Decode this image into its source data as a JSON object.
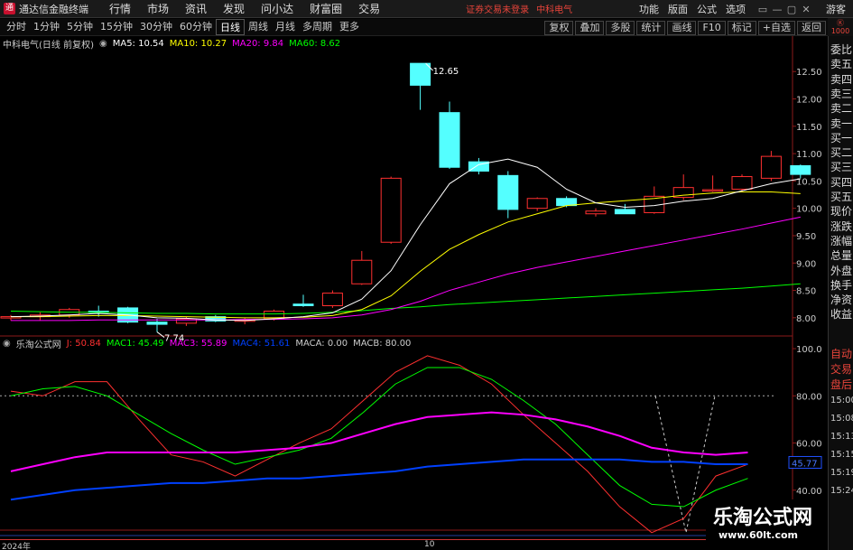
{
  "app": {
    "title": "通达信金融终端",
    "logo_glyph": "通"
  },
  "menu": [
    "行情",
    "市场",
    "资讯",
    "发现",
    "问小达",
    "财富圈",
    "交易"
  ],
  "status": {
    "text": "证券交易未登录",
    "stock": "中科电气"
  },
  "right_menu": [
    "功能",
    "版面",
    "公式",
    "选项"
  ],
  "window_buttons": [
    "▭",
    "—",
    "▢",
    "✕"
  ],
  "guest": "游客",
  "top_badge": [
    "Ⓚ",
    "1000"
  ],
  "periods": [
    {
      "label": "分时",
      "active": false
    },
    {
      "label": "1分钟",
      "active": false
    },
    {
      "label": "5分钟",
      "active": false
    },
    {
      "label": "15分钟",
      "active": false
    },
    {
      "label": "30分钟",
      "active": false
    },
    {
      "label": "60分钟",
      "active": false
    },
    {
      "label": "日线",
      "active": true
    },
    {
      "label": "周线",
      "active": false
    },
    {
      "label": "月线",
      "active": false
    },
    {
      "label": "多周期",
      "active": false
    },
    {
      "label": "更多",
      "active": false
    }
  ],
  "tools": [
    "复权",
    "叠加",
    "多股",
    "统计",
    "画线",
    "F10",
    "标记",
    "+自选",
    "返回"
  ],
  "main_legend": {
    "stock": "中科电气(日线 前复权)",
    "items": [
      {
        "label": "MA5: 10.54",
        "color": "#ffffff"
      },
      {
        "label": "MA10: 10.27",
        "color": "#ffff00"
      },
      {
        "label": "MA20: 9.84",
        "color": "#ff00ff"
      },
      {
        "label": "MA60: 8.62",
        "color": "#00ff00"
      }
    ]
  },
  "sub_legend": {
    "name": "乐淘公式网",
    "items": [
      {
        "label": "J: 50.84",
        "color": "#ff3030"
      },
      {
        "label": "MAC1: 45.49",
        "color": "#00ff00"
      },
      {
        "label": "MAC3: 55.89",
        "color": "#ff00ff"
      },
      {
        "label": "MAC4: 51.61",
        "color": "#0040ff"
      },
      {
        "label": "MACA: 0.00",
        "color": "#cccccc"
      },
      {
        "label": "MACB: 80.00",
        "color": "#cccccc"
      }
    ]
  },
  "side_panel": {
    "items": [
      "委比",
      "卖五",
      "卖四",
      "卖三",
      "卖二",
      "卖一",
      "买一",
      "买二",
      "买三",
      "买四",
      "买五",
      "现价",
      "涨跌",
      "涨幅",
      "总量",
      "外盘",
      "换手",
      "净资",
      "收益"
    ],
    "lower": [
      {
        "label": "自动",
        "red": true
      },
      {
        "label": "交易",
        "red": true
      },
      {
        "label": "盘后",
        "red": true
      }
    ],
    "times": [
      "15:00",
      "15:08",
      "15:13",
      "15:15",
      "15:19",
      "15:24"
    ]
  },
  "price_axis": [
    "12.50",
    "12.00",
    "11.50",
    "11.00",
    "10.50",
    "10.00",
    "9.50",
    "9.00",
    "8.50",
    "8.00"
  ],
  "sub_axis": [
    "100.0",
    "80.00",
    "60.00",
    "40.00"
  ],
  "sub_axis_marker": "45.77",
  "annotations": {
    "high": "12.65",
    "low": "7.74"
  },
  "date_labels": [
    "2024年",
    "10"
  ],
  "watermark": {
    "main": "乐淘公式网",
    "url": "www.60lt.com"
  },
  "colors": {
    "up": "#ff3030",
    "down": "#54ffff",
    "ma5": "#ffffff",
    "ma10": "#ffff00",
    "ma20": "#ff00ff",
    "ma60": "#00ff00"
  },
  "chart_data": {
    "type": "candlestick",
    "candles": [
      {
        "o": 8.0,
        "h": 8.05,
        "l": 7.95,
        "c": 8.02
      },
      {
        "o": 8.02,
        "h": 8.1,
        "l": 7.95,
        "c": 8.05
      },
      {
        "o": 8.05,
        "h": 8.18,
        "l": 8.0,
        "c": 8.15
      },
      {
        "o": 8.12,
        "h": 8.22,
        "l": 8.02,
        "c": 8.1
      },
      {
        "o": 8.18,
        "h": 8.2,
        "l": 7.9,
        "c": 7.92
      },
      {
        "o": 7.92,
        "h": 7.98,
        "l": 7.74,
        "c": 7.88
      },
      {
        "o": 7.9,
        "h": 8.02,
        "l": 7.85,
        "c": 7.98
      },
      {
        "o": 8.02,
        "h": 8.05,
        "l": 7.92,
        "c": 7.94
      },
      {
        "o": 7.95,
        "h": 8.0,
        "l": 7.88,
        "c": 7.96
      },
      {
        "o": 7.98,
        "h": 8.15,
        "l": 7.95,
        "c": 8.12
      },
      {
        "o": 8.25,
        "h": 8.42,
        "l": 8.2,
        "c": 8.22
      },
      {
        "o": 8.22,
        "h": 8.5,
        "l": 8.18,
        "c": 8.45
      },
      {
        "o": 8.62,
        "h": 9.22,
        "l": 8.6,
        "c": 9.05
      },
      {
        "o": 9.38,
        "h": 10.58,
        "l": 9.35,
        "c": 10.55
      },
      {
        "o": 12.65,
        "h": 12.65,
        "l": 11.8,
        "c": 12.25
      },
      {
        "o": 11.75,
        "h": 11.95,
        "l": 10.72,
        "c": 10.75
      },
      {
        "o": 10.85,
        "h": 10.92,
        "l": 10.62,
        "c": 10.68
      },
      {
        "o": 10.6,
        "h": 10.68,
        "l": 9.82,
        "c": 9.98
      },
      {
        "o": 10.0,
        "h": 10.2,
        "l": 9.95,
        "c": 10.18
      },
      {
        "o": 10.18,
        "h": 10.22,
        "l": 10.02,
        "c": 10.05
      },
      {
        "o": 9.9,
        "h": 10.0,
        "l": 9.85,
        "c": 9.95
      },
      {
        "o": 9.98,
        "h": 10.08,
        "l": 9.95,
        "c": 9.9
      },
      {
        "o": 9.92,
        "h": 10.4,
        "l": 9.9,
        "c": 10.22
      },
      {
        "o": 10.2,
        "h": 10.62,
        "l": 10.15,
        "c": 10.38
      },
      {
        "o": 10.32,
        "h": 10.6,
        "l": 10.3,
        "c": 10.34
      },
      {
        "o": 10.35,
        "h": 10.62,
        "l": 10.3,
        "c": 10.58
      },
      {
        "o": 10.55,
        "h": 11.05,
        "l": 10.5,
        "c": 10.95
      },
      {
        "o": 10.78,
        "h": 10.8,
        "l": 10.55,
        "c": 10.62
      }
    ],
    "ma5": [
      8.02,
      8.03,
      8.05,
      8.08,
      8.05,
      8.0,
      7.99,
      7.96,
      7.95,
      7.98,
      8.02,
      8.09,
      8.34,
      8.86,
      9.7,
      10.45,
      10.8,
      10.9,
      10.75,
      10.35,
      10.1,
      10.02,
      10.05,
      10.13,
      10.18,
      10.32,
      10.45,
      10.54
    ],
    "ma10": [
      8.02,
      8.02,
      8.03,
      8.04,
      8.04,
      8.03,
      8.02,
      8.01,
      8.0,
      8.0,
      8.01,
      8.04,
      8.15,
      8.4,
      8.85,
      9.25,
      9.52,
      9.75,
      9.9,
      10.05,
      10.1,
      10.14,
      10.18,
      10.24,
      10.28,
      10.3,
      10.3,
      10.27
    ],
    "ma20": [
      7.95,
      7.95,
      7.95,
      7.96,
      7.96,
      7.96,
      7.96,
      7.96,
      7.97,
      7.97,
      7.98,
      8.0,
      8.05,
      8.15,
      8.3,
      8.5,
      8.65,
      8.8,
      8.92,
      9.02,
      9.12,
      9.22,
      9.32,
      9.42,
      9.52,
      9.62,
      9.73,
      9.84
    ],
    "ma60": [
      8.12,
      8.11,
      8.1,
      8.1,
      8.09,
      8.08,
      8.08,
      8.07,
      8.07,
      8.07,
      8.08,
      8.1,
      8.13,
      8.17,
      8.2,
      8.24,
      8.27,
      8.3,
      8.33,
      8.36,
      8.39,
      8.42,
      8.45,
      8.48,
      8.51,
      8.54,
      8.58,
      8.62
    ],
    "price_ylim": [
      7.7,
      12.9
    ],
    "sub_ylim": [
      20,
      105
    ],
    "sub_series": [
      {
        "name": "J",
        "color": "#ff3030",
        "values": [
          82,
          80,
          86,
          86,
          70,
          55,
          52,
          46,
          53,
          60,
          66,
          78,
          90,
          97,
          93,
          85,
          72,
          60,
          48,
          33,
          22,
          28,
          46,
          51
        ]
      },
      {
        "name": "MAC1",
        "color": "#00ff00",
        "values": [
          80,
          83,
          84,
          80,
          72,
          64,
          57,
          51,
          54,
          57,
          62,
          73,
          85,
          92,
          92,
          87,
          78,
          68,
          55,
          42,
          34,
          33,
          40,
          45
        ]
      },
      {
        "name": "MAC3",
        "color": "#ff00ff",
        "values": [
          48,
          51,
          54,
          56,
          56,
          56,
          56,
          56,
          57,
          58,
          60,
          64,
          68,
          71,
          72,
          73,
          72,
          70,
          67,
          63,
          58,
          56,
          55,
          56
        ]
      },
      {
        "name": "MAC4",
        "color": "#0040ff",
        "values": [
          36,
          38,
          40,
          41,
          42,
          43,
          43,
          44,
          45,
          45,
          46,
          47,
          48,
          50,
          51,
          52,
          53,
          53,
          53,
          53,
          52,
          52,
          51,
          51
        ]
      }
    ],
    "maca": 0,
    "macb": 80
  }
}
